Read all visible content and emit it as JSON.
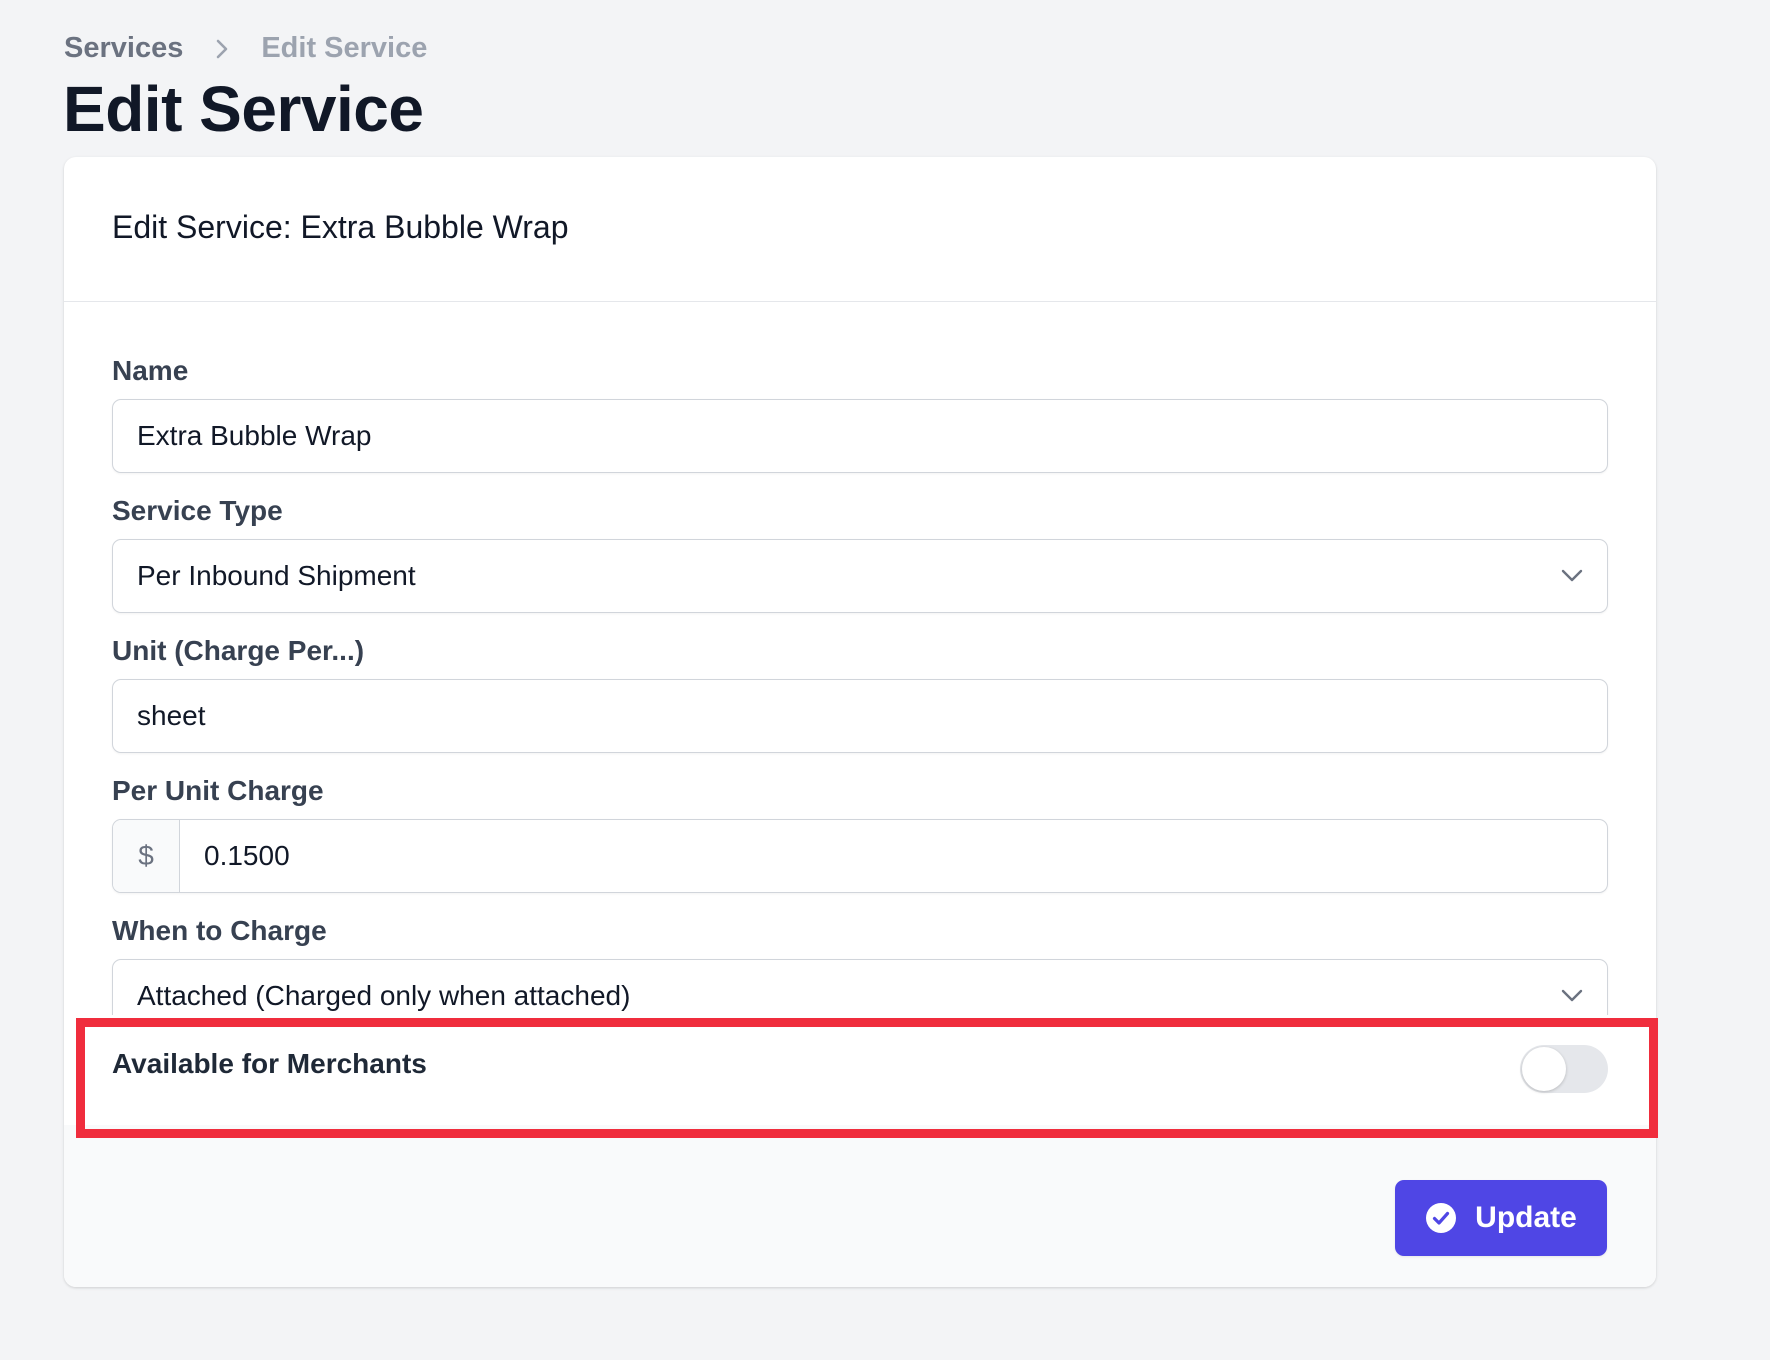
{
  "breadcrumb": {
    "items": [
      "Services",
      "Edit Service"
    ],
    "separator_icon": "chevron-right-icon"
  },
  "page": {
    "title": "Edit Service"
  },
  "card": {
    "title": "Edit Service: Extra Bubble Wrap"
  },
  "form": {
    "name": {
      "label": "Name",
      "value": "Extra Bubble Wrap"
    },
    "service_type": {
      "label": "Service Type",
      "value": "Per Inbound Shipment",
      "icon": "chevron-down-icon"
    },
    "unit": {
      "label": "Unit (Charge Per...)",
      "value": "sheet"
    },
    "per_unit_charge": {
      "label": "Per Unit Charge",
      "currency": "$",
      "value": "0.1500"
    },
    "when_to_charge": {
      "label": "When to Charge",
      "value": "Attached (Charged only when attached)",
      "icon": "chevron-down-icon"
    },
    "available_for_merchants": {
      "label": "Available for Merchants",
      "enabled": false
    }
  },
  "actions": {
    "update_label": "Update",
    "update_icon": "check-circle-icon"
  },
  "colors": {
    "background": "#f3f4f6",
    "primary": "#4f46e5",
    "highlight": "#f02d3d",
    "toggle_off": "#e5e7eb"
  }
}
